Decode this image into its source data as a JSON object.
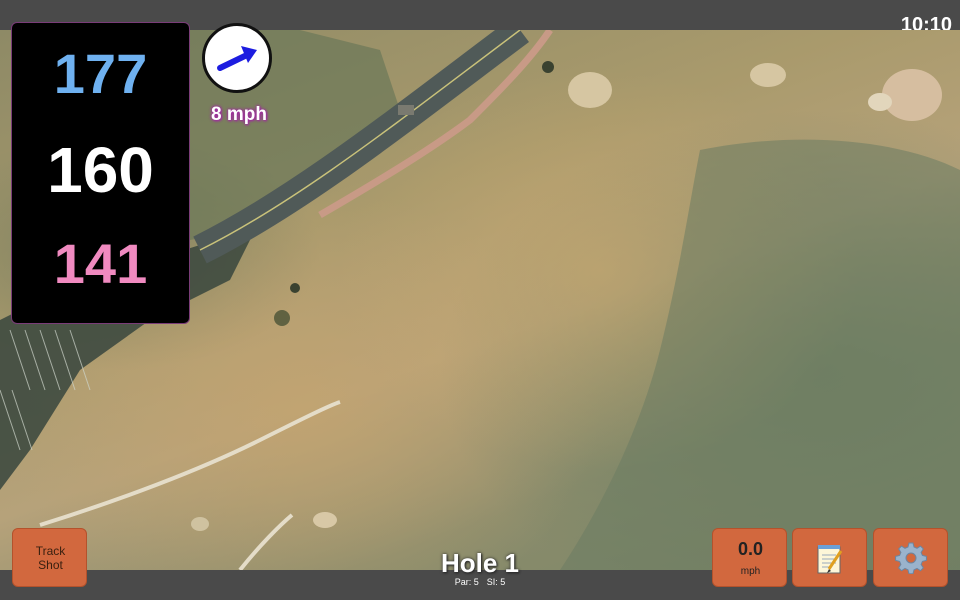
{
  "status_bar": {
    "time": "10:10"
  },
  "yardages": {
    "back": "177",
    "center": "160",
    "front": "141"
  },
  "wind": {
    "speed": "8 mph",
    "arrow": "arrow-right-up-icon"
  },
  "hole": {
    "title": "Hole 1",
    "par": "Par: 5",
    "stroke_index": "SI: 5"
  },
  "buttons": {
    "track_shot": "Track\nShot",
    "speed_value": "0.0",
    "speed_unit": "mph",
    "notes_icon": "notepad-icon",
    "settings_icon": "gear-icon"
  },
  "colors": {
    "back_yardage": "#6fb1f0",
    "center_yardage": "#ffffff",
    "front_yardage": "#f08ac0",
    "button_orange": "#d2683e",
    "wind_text_glow": "#a02aa0"
  }
}
